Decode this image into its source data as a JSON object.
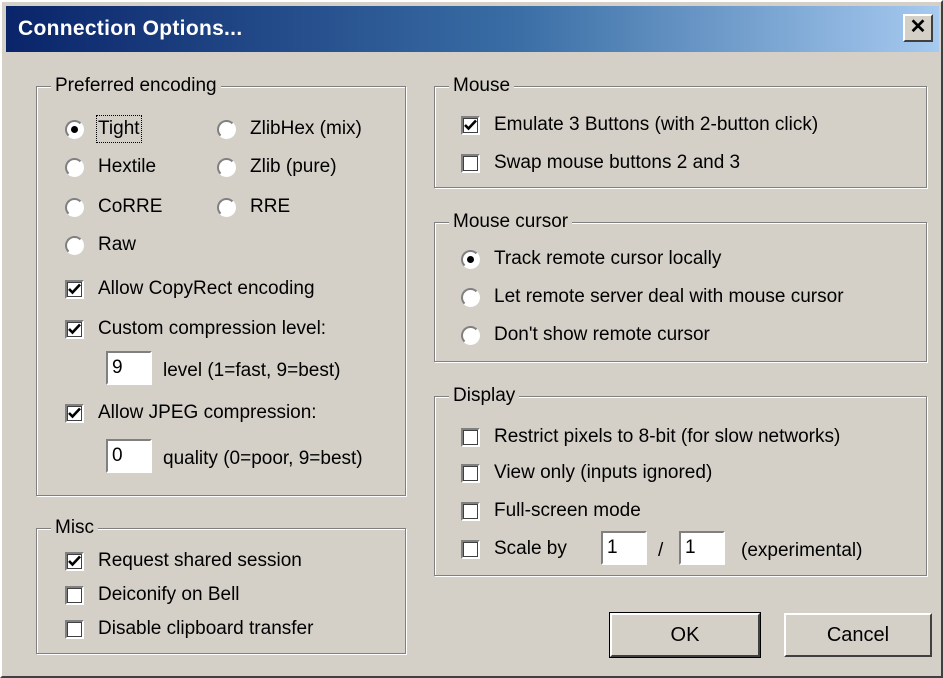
{
  "window": {
    "title": "Connection Options...",
    "close_glyph": "✕"
  },
  "preferred_encoding": {
    "legend": "Preferred encoding",
    "encodings": {
      "tight": "Tight",
      "zlibhex": "ZlibHex (mix)",
      "hextile": "Hextile",
      "zlib": "Zlib (pure)",
      "corre": "CoRRE",
      "rre": "RRE",
      "raw": "Raw"
    },
    "selected": "Tight",
    "allow_copyrect": {
      "label": "Allow CopyRect encoding",
      "checked": true
    },
    "custom_compression": {
      "label": "Custom compression level:",
      "checked": true,
      "value": "9",
      "hint": "level (1=fast, 9=best)"
    },
    "allow_jpeg": {
      "label": "Allow JPEG compression:",
      "checked": true,
      "value": "0",
      "hint": "quality (0=poor, 9=best)"
    }
  },
  "misc": {
    "legend": "Misc",
    "request_shared": {
      "label": "Request shared session",
      "checked": true
    },
    "deiconify": {
      "label": "Deiconify on Bell",
      "checked": false
    },
    "disable_clipboard": {
      "label": "Disable clipboard transfer",
      "checked": false
    }
  },
  "mouse": {
    "legend": "Mouse",
    "emulate3": {
      "label": "Emulate 3 Buttons (with 2-button click)",
      "checked": true
    },
    "swap23": {
      "label": "Swap mouse buttons 2 and 3",
      "checked": false
    }
  },
  "mouse_cursor": {
    "legend": "Mouse cursor",
    "options": {
      "track": "Track remote cursor locally",
      "server": "Let remote server deal with mouse cursor",
      "hide": "Don't show remote cursor"
    },
    "selected": "Track remote cursor locally"
  },
  "display": {
    "legend": "Display",
    "restrict8bit": {
      "label": "Restrict pixels to 8-bit (for slow networks)",
      "checked": false
    },
    "view_only": {
      "label": "View only (inputs ignored)",
      "checked": false
    },
    "fullscreen": {
      "label": "Full-screen mode",
      "checked": false
    },
    "scale": {
      "label": "Scale by",
      "checked": false,
      "numerator": "1",
      "separator": "/",
      "denominator": "1",
      "note": "(experimental)"
    }
  },
  "buttons": {
    "ok": "OK",
    "cancel": "Cancel"
  },
  "icons": {
    "checkmark": "checkmark-icon",
    "radio_dot": "radio-dot-icon",
    "close": "close-icon"
  }
}
